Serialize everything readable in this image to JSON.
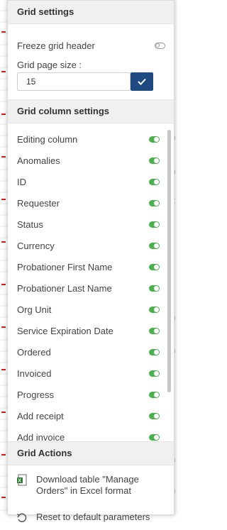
{
  "grid_settings": {
    "header": "Grid settings",
    "freeze_label": "Freeze grid header",
    "freeze_on": false,
    "page_size_label": "Grid page size :",
    "page_size_value": "15"
  },
  "grid_columns": {
    "header": "Grid column settings",
    "items": [
      {
        "label": "Editing column",
        "on": true
      },
      {
        "label": "Anomalies",
        "on": true
      },
      {
        "label": "ID",
        "on": true
      },
      {
        "label": "Requester",
        "on": true
      },
      {
        "label": "Status",
        "on": true
      },
      {
        "label": "Currency",
        "on": true
      },
      {
        "label": "Probationer First Name",
        "on": true
      },
      {
        "label": "Probationer Last Name",
        "on": true
      },
      {
        "label": "Org Unit",
        "on": true
      },
      {
        "label": "Service Expiration Date",
        "on": true
      },
      {
        "label": "Ordered",
        "on": true
      },
      {
        "label": "Invoiced",
        "on": true
      },
      {
        "label": "Progress",
        "on": true
      },
      {
        "label": "Add receipt",
        "on": true
      },
      {
        "label": "Add invoice",
        "on": true
      }
    ]
  },
  "grid_actions": {
    "header": "Grid Actions",
    "download_line1": "Download table \"Manage",
    "download_line2": "Orders\" in Excel format",
    "reset_label": "Reset to default parameters"
  },
  "background_fragments": [
    "n",
    "n",
    "2",
    "n",
    "n",
    "n",
    "n"
  ],
  "colors": {
    "toggle_on": "#4caf50",
    "confirm_button": "#1f4a80",
    "section_header_bg": "#f0f0f0"
  }
}
